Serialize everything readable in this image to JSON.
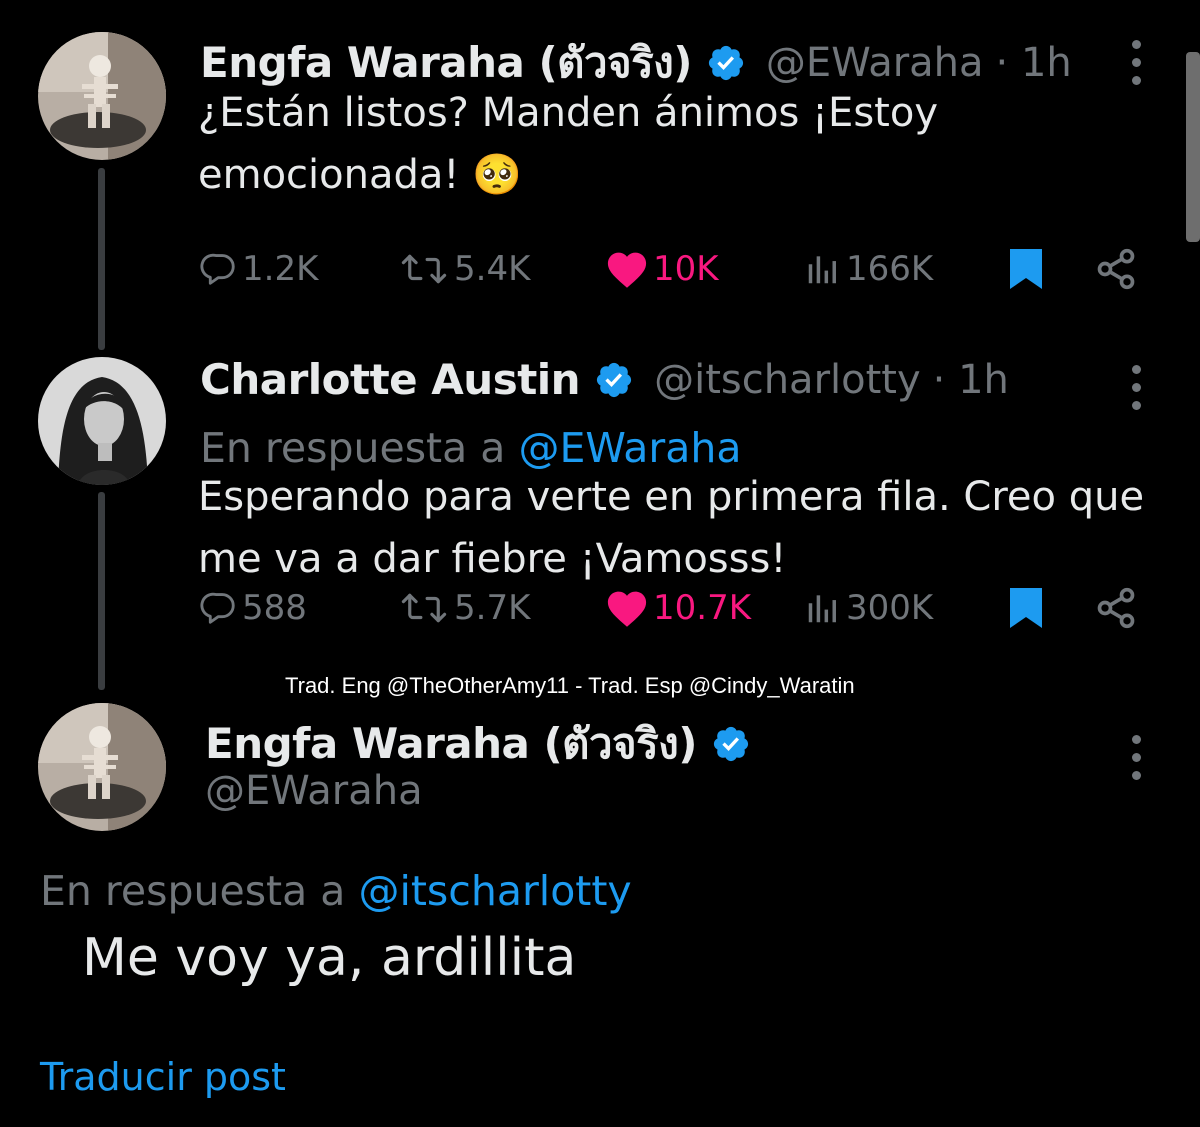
{
  "tweets": [
    {
      "author": {
        "display_name": "Engfa Waraha (ตัวจริง)",
        "handle": "@EWaraha",
        "time": "· 1h",
        "verified": true
      },
      "text_line1": "¿Están listos? Manden ánimos ¡Estoy",
      "text_line2": "emocionada! 🥺",
      "stats": {
        "replies": "1.2K",
        "reposts": "5.4K",
        "likes": "10K",
        "views": "166K"
      }
    },
    {
      "author": {
        "display_name": "Charlotte Austin",
        "handle": "@itscharlotty",
        "time": "· 1h",
        "verified": true
      },
      "reply_prefix": "En respuesta a",
      "reply_mention": "@EWaraha",
      "text_line1": "Esperando para verte en primera fila. Creo que",
      "text_line2": "me va a dar fiebre ¡Vamosss!",
      "stats": {
        "replies": "588",
        "reposts": "5.7K",
        "likes": "10.7K",
        "views": "300K"
      }
    }
  ],
  "credit_overlay": "Trad. Eng @TheOtherAmy11 - Trad. Esp @Cindy_Waratin",
  "main_post": {
    "author": {
      "display_name": "Engfa Waraha (ตัวจริง)",
      "handle": "@EWaraha",
      "verified": true
    },
    "reply_prefix": "En respuesta a",
    "reply_mention": "@itscharlotty",
    "text": "Me voy ya, ardillita",
    "translate_label": "Traducir post"
  },
  "colors": {
    "background": "#000000",
    "text": "#e7e9ea",
    "muted": "#71767b",
    "accent": "#1d9bf0",
    "like": "#f91880",
    "thread_line": "#3a3d40"
  },
  "icons": [
    "verified-badge-icon",
    "more-options-icon",
    "reply-icon",
    "repost-icon",
    "like-icon",
    "views-icon",
    "bookmark-icon",
    "share-icon"
  ]
}
